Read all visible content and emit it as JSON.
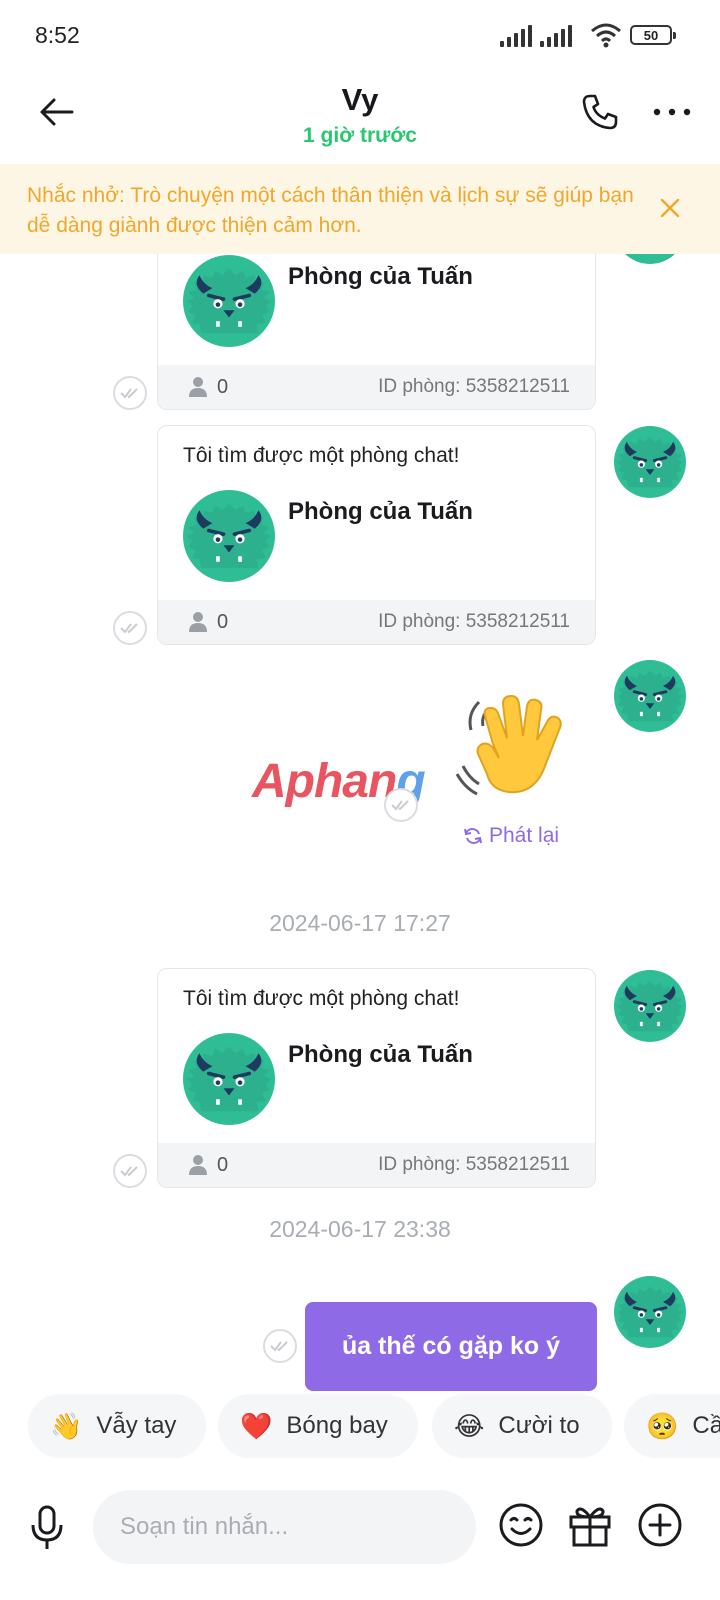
{
  "status_bar": {
    "time": "8:52",
    "battery": "50"
  },
  "header": {
    "contact_name": "Vy",
    "last_seen": "1 giờ trước"
  },
  "reminder": {
    "text": "Nhắc nhở: Trò chuyện một cách thân thiện và lịch sự sẽ giúp bạn dễ dàng giành được thiện cảm hơn."
  },
  "messages": {
    "card1": {
      "room_name": "Phòng của Tuấn",
      "member_count": "0",
      "room_id": "ID phòng: 5358212511"
    },
    "card2": {
      "text": "Tôi tìm được một phòng chat!",
      "room_name": "Phòng của Tuấn",
      "member_count": "0",
      "room_id": "ID phòng: 5358212511"
    },
    "sticker": {
      "replay_label": "Phát lại"
    },
    "timestamp1": "2024-06-17 17:27",
    "card3": {
      "text": "Tôi tìm được một phòng chat!",
      "room_name": "Phòng của Tuấn",
      "member_count": "0",
      "room_id": "ID phòng: 5358212511"
    },
    "timestamp2": "2024-06-17 23:38",
    "bubble": {
      "text": "ủa thế có gặp ko ý"
    }
  },
  "watermark": {
    "part1": "Aphan",
    "part2": "g"
  },
  "quick_reactions": [
    {
      "emoji": "👋",
      "label": "Vẫy tay"
    },
    {
      "emoji": "❤️",
      "label": "Bóng bay"
    },
    {
      "emoji": "😂",
      "label": "Cười to"
    },
    {
      "emoji": "🥺",
      "label": "Cầ"
    }
  ],
  "composer": {
    "placeholder": "Soạn tin nhắn..."
  },
  "colors": {
    "accent": "#8e6ae6",
    "online": "#28c76f",
    "reminder_text": "#f0a72b",
    "reminder_bg": "#fef6e4",
    "avatar": "#2ebd95"
  }
}
